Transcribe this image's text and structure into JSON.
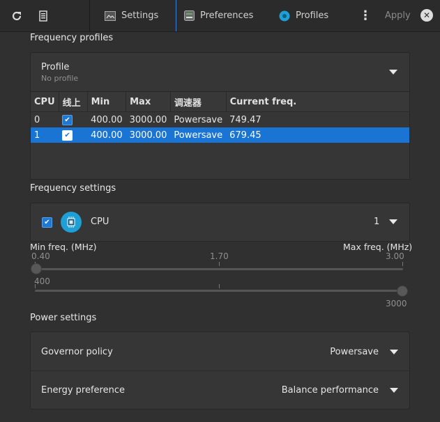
{
  "header": {
    "tabs": [
      {
        "label": "Settings",
        "icon": "settings-icon"
      },
      {
        "label": "Preferences",
        "icon": "preferences-icon"
      },
      {
        "label": "Profiles",
        "icon": "profiles-icon"
      }
    ],
    "apply_label": "Apply",
    "close_glyph": "✕",
    "menu_glyph": "⋮"
  },
  "frequency_profiles": {
    "title": "Frequency profiles",
    "profile_label": "Profile",
    "profile_value": "No profile",
    "table": {
      "headers": [
        "CPU",
        "线上",
        "Min",
        "Max",
        "调速器",
        "Current freq."
      ],
      "rows": [
        {
          "cpu": "0",
          "online": true,
          "min": "400.00",
          "max": "3000.00",
          "governor": "Powersave",
          "freq": "749.47",
          "selected": false
        },
        {
          "cpu": "1",
          "online": true,
          "min": "400.00",
          "max": "3000.00",
          "governor": "Powersave",
          "freq": "679.45",
          "selected": true
        }
      ]
    }
  },
  "frequency_settings": {
    "title": "Frequency settings",
    "cpu_label": "CPU",
    "cpu_value": "1",
    "min_label": "Min freq. (MHz)",
    "max_label": "Max freq. (MHz)",
    "scale_min": "0.40",
    "scale_mid": "1.70",
    "scale_max": "3.00",
    "min_value": "400",
    "max_value": "3000",
    "min_fraction": 0.0,
    "max_fraction": 1.0
  },
  "power_settings": {
    "title": "Power settings",
    "governor_label": "Governor policy",
    "governor_value": "Powersave",
    "energy_label": "Energy preference",
    "energy_value": "Balance performance"
  },
  "colors": {
    "accent": "#1a74d4",
    "background": "#303030",
    "cpu_badge": "#1e9fd6"
  }
}
